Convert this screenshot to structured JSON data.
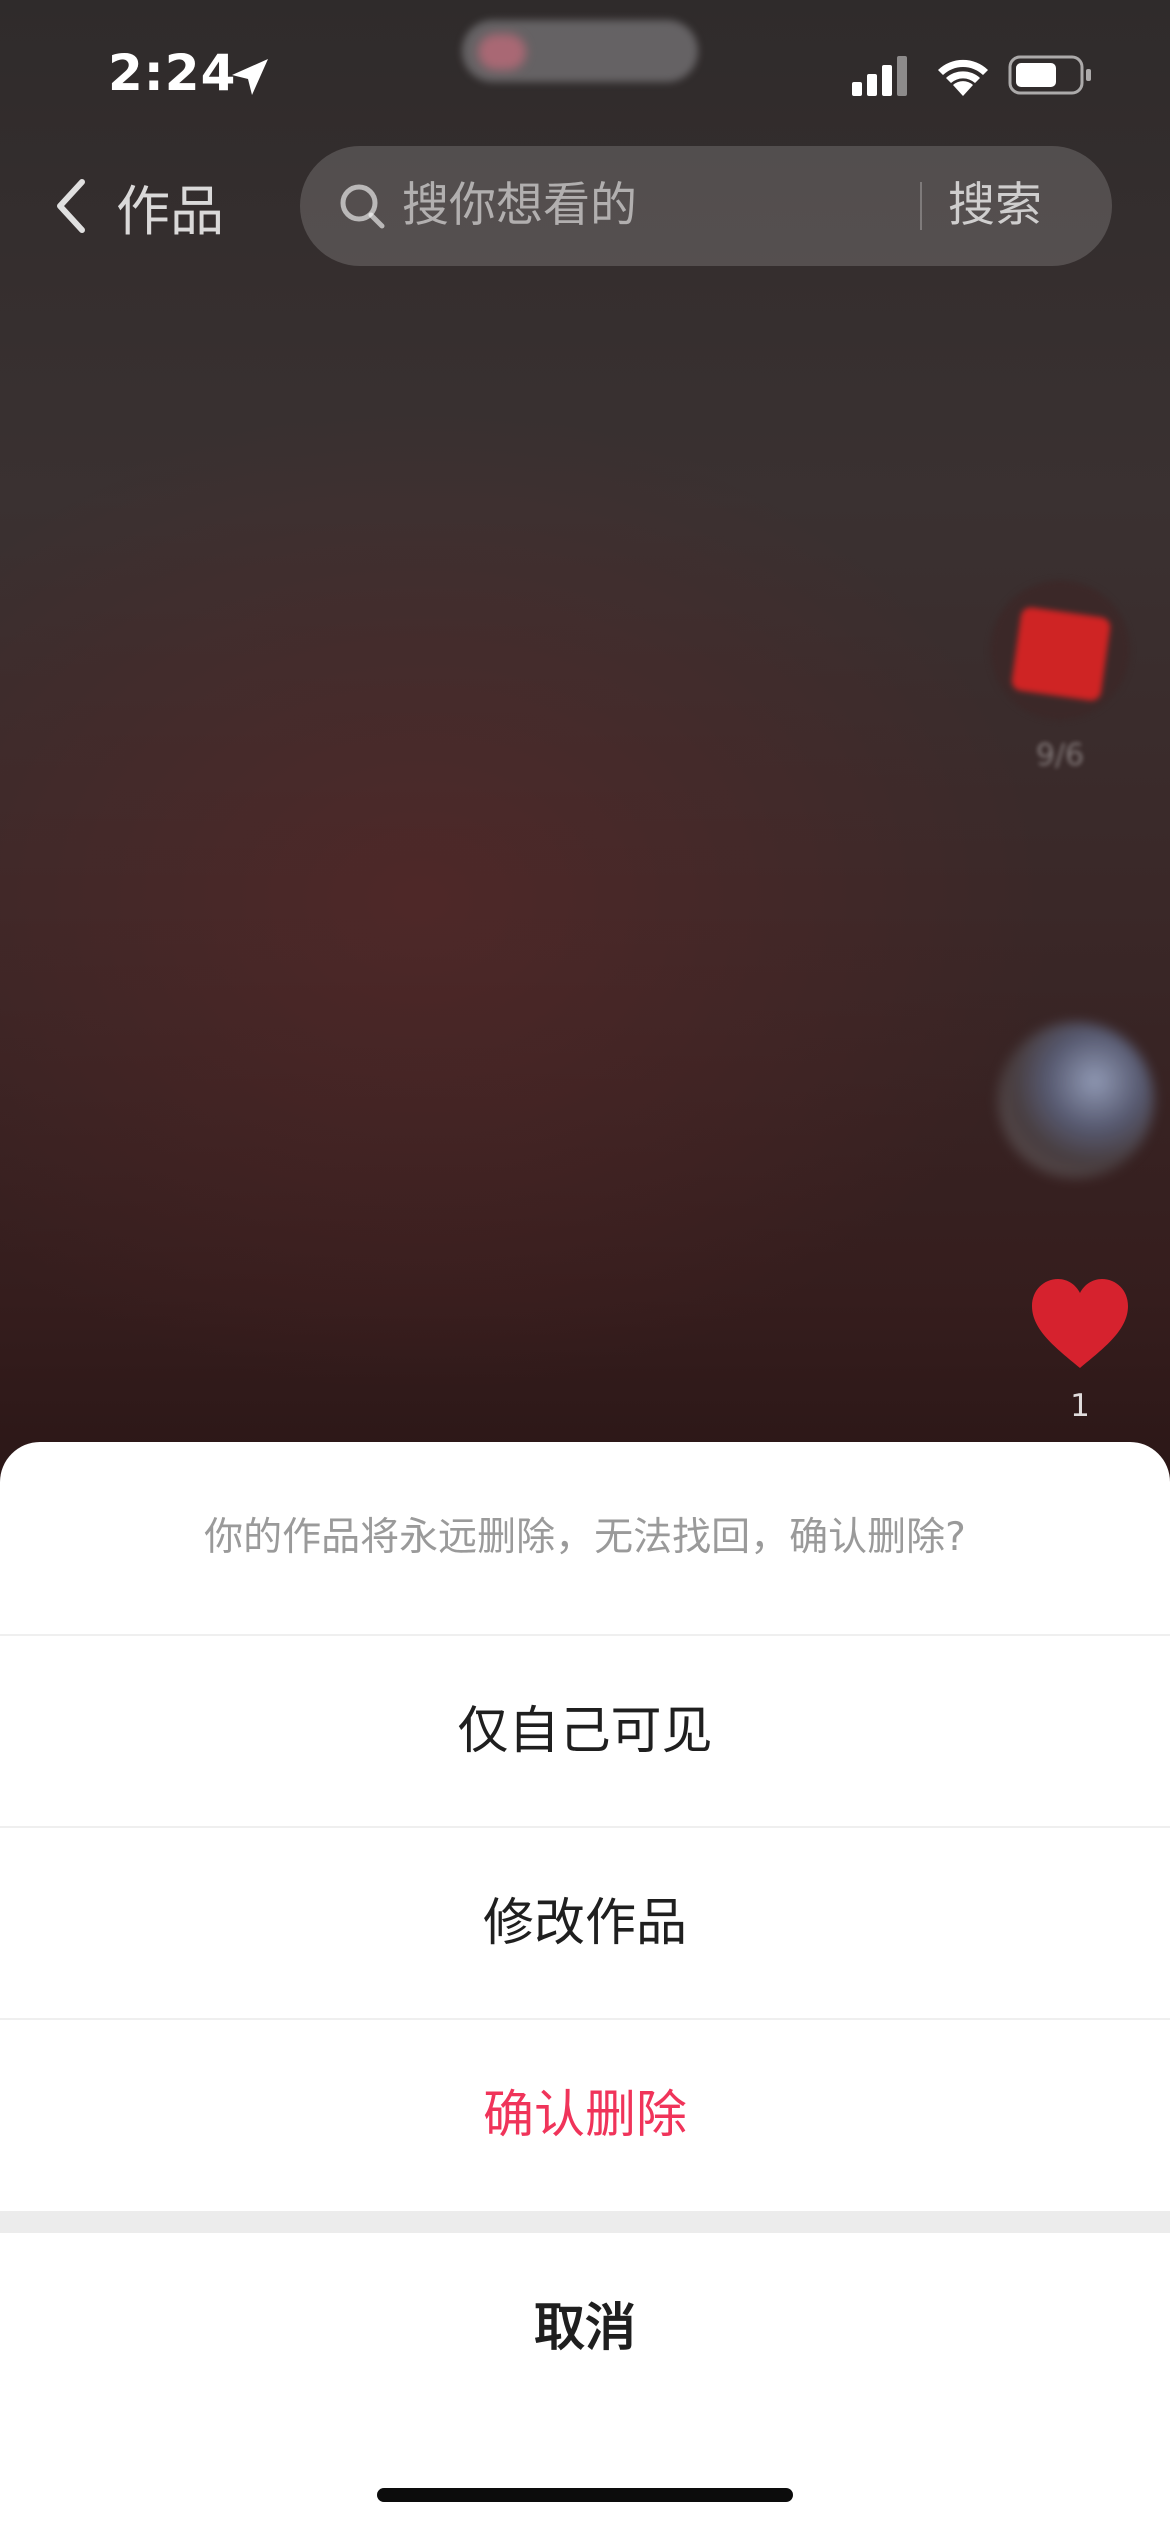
{
  "status_bar": {
    "time": "2:24",
    "icons": [
      "location-arrow-icon",
      "signal-icon",
      "wifi-icon",
      "battery-icon"
    ]
  },
  "nav": {
    "back_label": "作品",
    "search_placeholder": "搜你想看的",
    "search_button": "搜索"
  },
  "right_rail": {
    "avatar_count": "9/6",
    "like_count": "1",
    "like_color": "#d6222e"
  },
  "action_sheet": {
    "message": "你的作品将永远删除，无法找回，确认删除?",
    "options": [
      {
        "label": "仅自己可见"
      },
      {
        "label": "修改作品"
      },
      {
        "label": "确认删除",
        "color": "#f0345a"
      }
    ],
    "cancel_label": "取消"
  }
}
